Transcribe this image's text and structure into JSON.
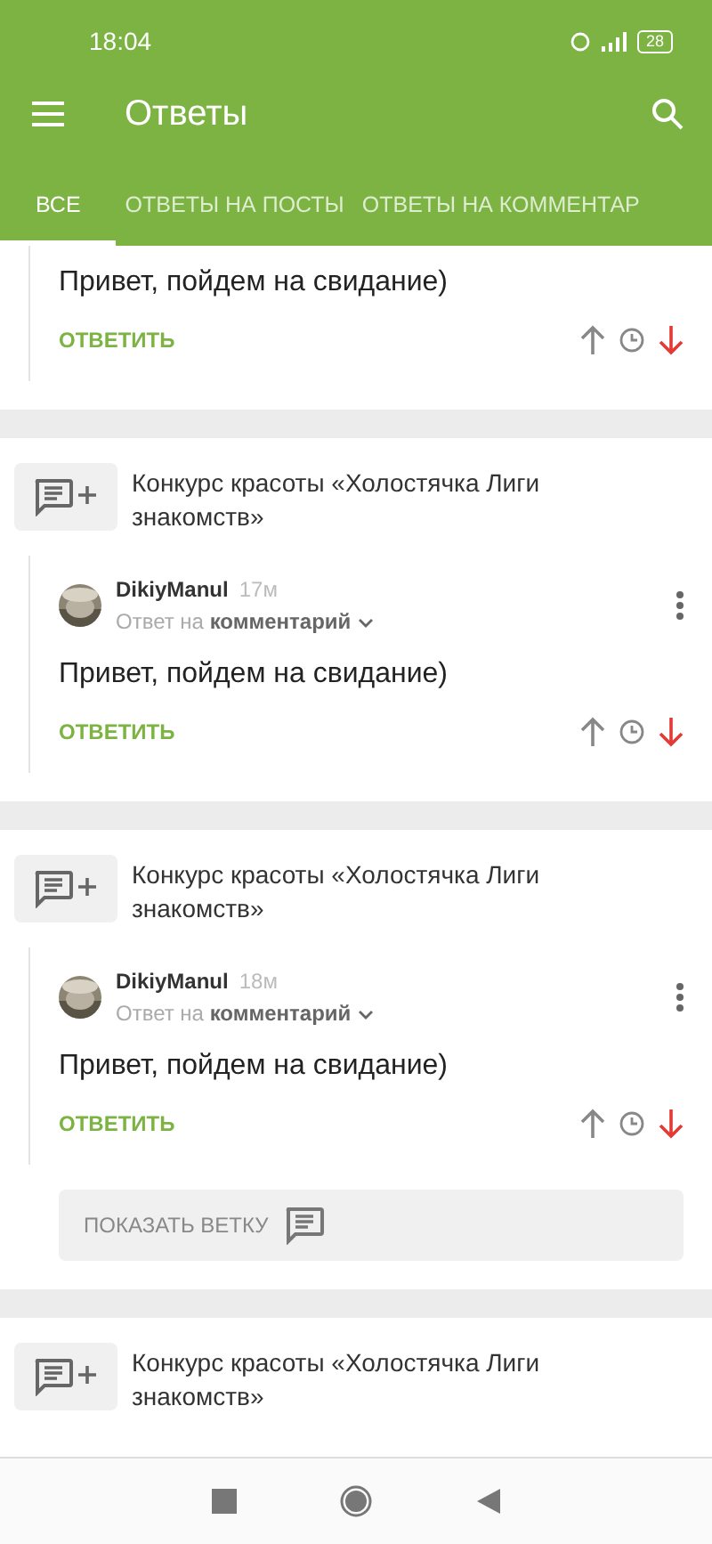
{
  "status_bar": {
    "time": "18:04",
    "battery": "28"
  },
  "toolbar": {
    "title": "Ответы"
  },
  "tabs": [
    {
      "label": "ВСЕ",
      "selected": true
    },
    {
      "label": "ОТВЕТЫ НА ПОСТЫ",
      "selected": false
    },
    {
      "label": "ОТВЕТЫ НА КОММЕНТАР",
      "selected": false
    }
  ],
  "cards": [
    {
      "comment": {
        "body": "Привет, пойдем на свидание)",
        "reply": "ОТВЕТИТЬ",
        "downvoted": true
      }
    },
    {
      "post": "Конкурс красоты «Холостячка Лиги знакомств»",
      "comment": {
        "author": "DikiyManul",
        "time": "17м",
        "reply_to_prefix": "Ответ на",
        "reply_to": "комментарий",
        "body": "Привет, пойдем на свидание)",
        "reply": "ОТВЕТИТЬ",
        "downvoted": true
      }
    },
    {
      "post": "Конкурс красоты «Холостячка Лиги знакомств»",
      "comment": {
        "author": "DikiyManul",
        "time": "18м",
        "reply_to_prefix": "Ответ на",
        "reply_to": "комментарий",
        "body": "Привет, пойдем на свидание)",
        "reply": "ОТВЕТИТЬ",
        "downvoted": true
      },
      "show_thread": "ПОКАЗАТЬ ВЕТКУ"
    },
    {
      "post": "Конкурс красоты «Холостячка Лиги знакомств»"
    }
  ]
}
